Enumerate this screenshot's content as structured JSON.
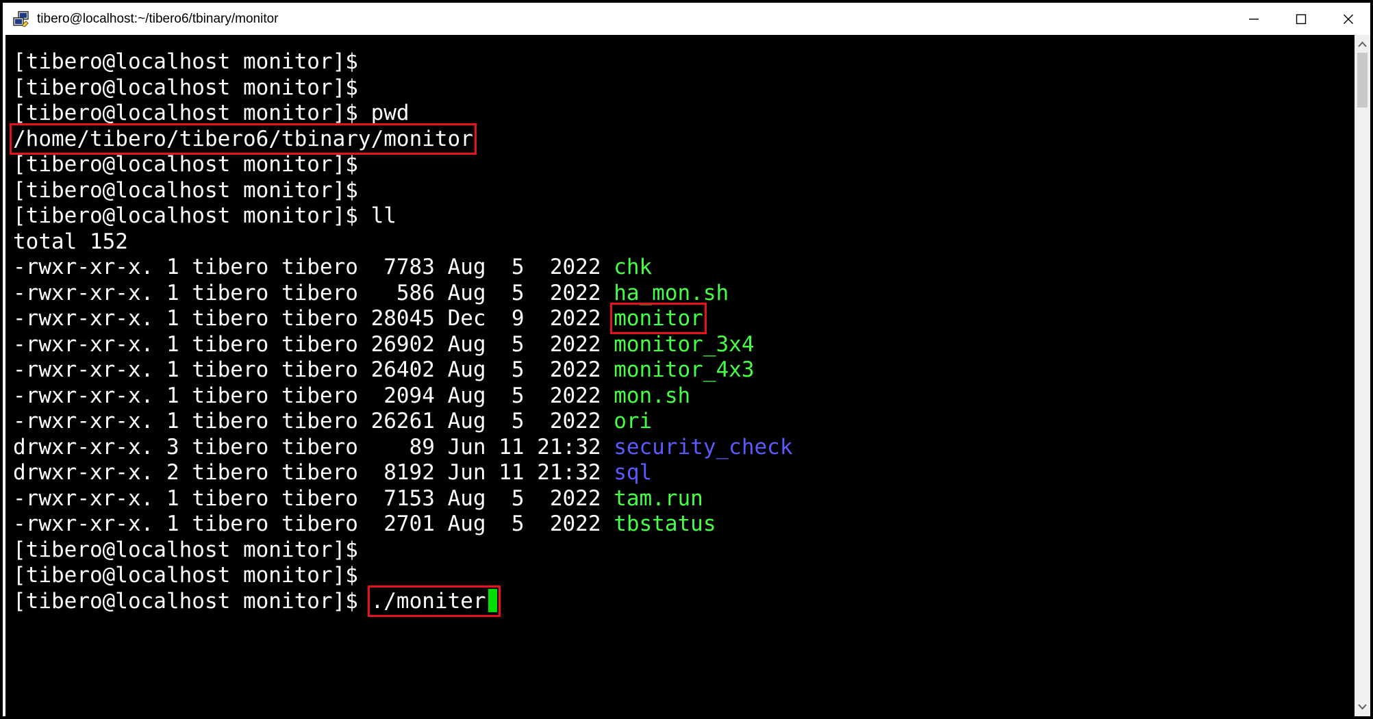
{
  "window": {
    "title": "tibero@localhost:~/tibero6/tbinary/monitor",
    "icon": "putty-icon",
    "controls": [
      "minimize-icon",
      "maximize-icon",
      "close-icon"
    ]
  },
  "terminal": {
    "lines": [
      "[tibero@localhost monitor]$",
      "[tibero@localhost monitor]$",
      "[tibero@localhost monitor]$ pwd",
      "/home/tibero/tibero6/tbinary/monitor",
      "[tibero@localhost monitor]$",
      "[tibero@localhost monitor]$",
      "[tibero@localhost monitor]$ ll",
      "total 152"
    ],
    "listing": [
      {
        "perm": "-rwxr-xr-x.",
        "links": "1",
        "owner": "tibero",
        "group": "tibero",
        "size": "7783",
        "month": "Aug",
        "day": "5",
        "time": "2022",
        "name": "chk",
        "color": "#44ff44"
      },
      {
        "perm": "-rwxr-xr-x.",
        "links": "1",
        "owner": "tibero",
        "group": "tibero",
        "size": "586",
        "month": "Aug",
        "day": "5",
        "time": "2022",
        "name": "ha_mon.sh",
        "color": "#44ff44"
      },
      {
        "perm": "-rwxr-xr-x.",
        "links": "1",
        "owner": "tibero",
        "group": "tibero",
        "size": "28045",
        "month": "Dec",
        "day": "9",
        "time": "2022",
        "name": "monitor",
        "color": "#44ff44"
      },
      {
        "perm": "-rwxr-xr-x.",
        "links": "1",
        "owner": "tibero",
        "group": "tibero",
        "size": "26902",
        "month": "Aug",
        "day": "5",
        "time": "2022",
        "name": "monitor_3x4",
        "color": "#44ff44"
      },
      {
        "perm": "-rwxr-xr-x.",
        "links": "1",
        "owner": "tibero",
        "group": "tibero",
        "size": "26402",
        "month": "Aug",
        "day": "5",
        "time": "2022",
        "name": "monitor_4x3",
        "color": "#44ff44"
      },
      {
        "perm": "-rwxr-xr-x.",
        "links": "1",
        "owner": "tibero",
        "group": "tibero",
        "size": "2094",
        "month": "Aug",
        "day": "5",
        "time": "2022",
        "name": "mon.sh",
        "color": "#44ff44"
      },
      {
        "perm": "-rwxr-xr-x.",
        "links": "1",
        "owner": "tibero",
        "group": "tibero",
        "size": "26261",
        "month": "Aug",
        "day": "5",
        "time": "2022",
        "name": "ori",
        "color": "#44ff44"
      },
      {
        "perm": "drwxr-xr-x.",
        "links": "3",
        "owner": "tibero",
        "group": "tibero",
        "size": "89",
        "month": "Jun",
        "day": "11",
        "time": "21:32",
        "name": "security_check",
        "color": "#5a5aff"
      },
      {
        "perm": "drwxr-xr-x.",
        "links": "2",
        "owner": "tibero",
        "group": "tibero",
        "size": "8192",
        "month": "Jun",
        "day": "11",
        "time": "21:32",
        "name": "sql",
        "color": "#5a5aff"
      },
      {
        "perm": "-rwxr-xr-x.",
        "links": "1",
        "owner": "tibero",
        "group": "tibero",
        "size": "7153",
        "month": "Aug",
        "day": "5",
        "time": "2022",
        "name": "tam.run",
        "color": "#44ff44"
      },
      {
        "perm": "-rwxr-xr-x.",
        "links": "1",
        "owner": "tibero",
        "group": "tibero",
        "size": "2701",
        "month": "Aug",
        "day": "5",
        "time": "2022",
        "name": "tbstatus",
        "color": "#44ff44"
      }
    ],
    "after": [
      "[tibero@localhost monitor]$",
      "[tibero@localhost monitor]$"
    ],
    "prompt": "[tibero@localhost monitor]$ ",
    "input": "./moniter",
    "colors": {
      "background": "#000000",
      "text": "#ffffff",
      "executable": "#44ff44",
      "directory": "#5a5aff",
      "highlight_box": "#e8131a",
      "cursor": "#00e000"
    }
  }
}
